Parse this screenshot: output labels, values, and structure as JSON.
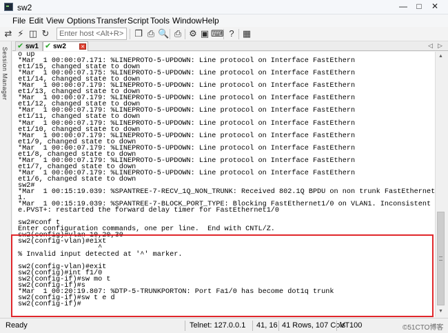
{
  "window": {
    "title": "sw2"
  },
  "menu": [
    "File",
    "Edit",
    "View",
    "Options",
    "Transfer",
    "Script",
    "Tools",
    "Window",
    "Help"
  ],
  "toolbar": {
    "host_placeholder": "Enter host <Alt+R>"
  },
  "sidebar": {
    "label": "Session Manager"
  },
  "tabs": [
    {
      "label": "sw1",
      "active": false
    },
    {
      "label": "sw2",
      "active": true
    }
  ],
  "terminal": {
    "lines": [
      "o up",
      "*Mar  1 00:00:07.171: %LINEPROTO-5-UPDOWN: Line protocol on Interface FastEthern",
      "et1/15, changed state to down",
      "*Mar  1 00:00:07.175: %LINEPROTO-5-UPDOWN: Line protocol on Interface FastEthern",
      "et1/14, changed state to down",
      "*Mar  1 00:00:07.179: %LINEPROTO-5-UPDOWN: Line protocol on Interface FastEthern",
      "et1/13, changed state to down",
      "*Mar  1 00:00:07.179: %LINEPROTO-5-UPDOWN: Line protocol on Interface FastEthern",
      "et1/12, changed state to down",
      "*Mar  1 00:00:07.179: %LINEPROTO-5-UPDOWN: Line protocol on Interface FastEthern",
      "et1/11, changed state to down",
      "*Mar  1 00:00:07.179: %LINEPROTO-5-UPDOWN: Line protocol on Interface FastEthern",
      "et1/10, changed state to down",
      "*Mar  1 00:00:07.179: %LINEPROTO-5-UPDOWN: Line protocol on Interface FastEthern",
      "et1/9, changed state to down",
      "*Mar  1 00:00:07.179: %LINEPROTO-5-UPDOWN: Line protocol on Interface FastEthern",
      "et1/8, changed state to down",
      "*Mar  1 00:00:07.179: %LINEPROTO-5-UPDOWN: Line protocol on Interface FastEthern",
      "et1/7, changed state to down",
      "*Mar  1 00:00:07.179: %LINEPROTO-5-UPDOWN: Line protocol on Interface FastEthern",
      "et1/6, changed state to down",
      "sw2#",
      "*Mar  1 00:15:19.039: %SPANTREE-7-RECV_1Q_NON_TRUNK: Received 802.1Q BPDU on non trunk FastEthernet1/0 VLAN",
      "1.",
      "*Mar  1 00:15:19.039: %SPANTREE-7-BLOCK_PORT_TYPE: Blocking FastEthernet1/0 on VLAN1. Inconsistent port typ",
      "e.PVST+: restarted the forward delay timer for FastEthernet1/0",
      "",
      "sw2#conf t",
      "Enter configuration commands, one per line.  End with CNTL/Z.",
      "sw2(config)#vlan 10,20,30",
      "sw2(config-vlan)#eixt",
      "                   ^",
      "% Invalid input detected at '^' marker.",
      "",
      "sw2(config-vlan)#exit",
      "sw2(config)#int f1/0",
      "sw2(config-if)#sw mo t",
      "sw2(config-if)#s",
      "*Mar  1 00:20:19.807: %DTP-5-TRUNKPORTON: Port Fa1/0 has become dot1q trunk",
      "sw2(config-if)#sw t e d",
      "sw2(config-if)#"
    ]
  },
  "status": {
    "state": "Ready",
    "connection": "Telnet: 127.0.0.1",
    "cursor": "41, 16",
    "size": "41 Rows, 107 Cols",
    "terminal_type": "VT100",
    "watermark": "©51CTO博客"
  },
  "colors": {
    "highlight": "#e0262a",
    "tab_check": "#2aa52a"
  }
}
